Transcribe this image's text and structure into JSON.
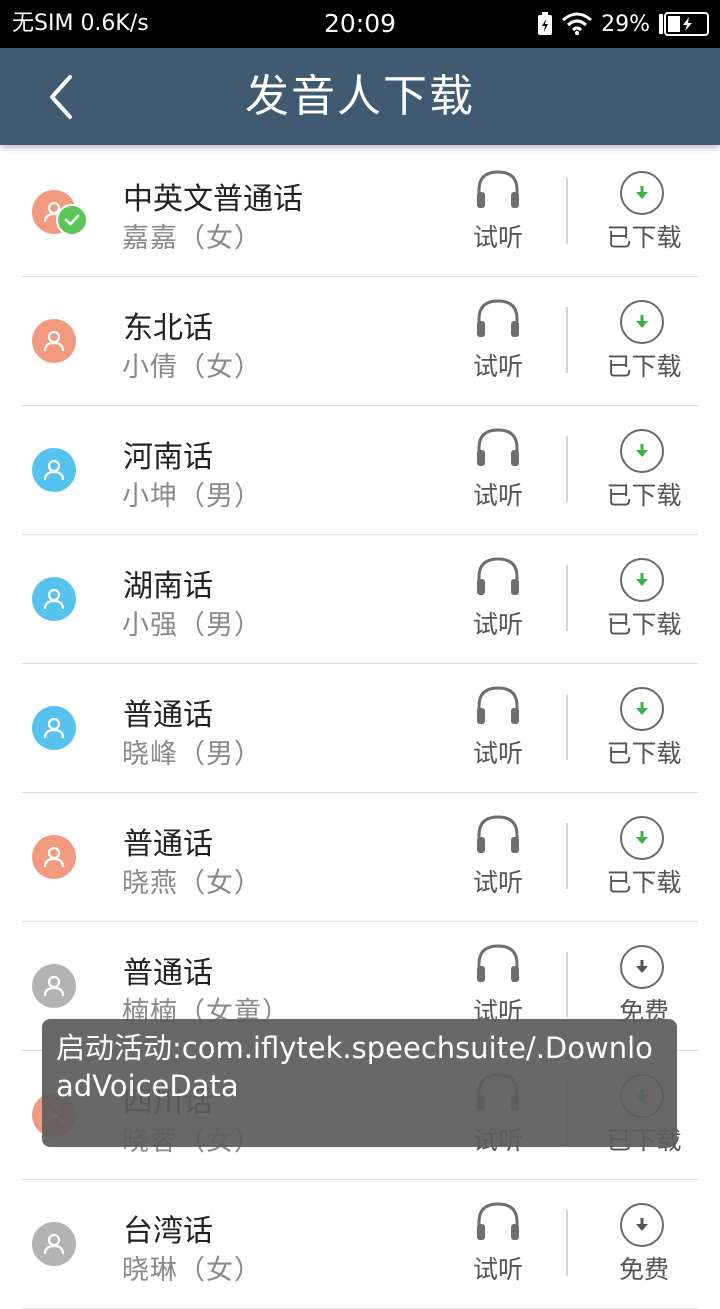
{
  "status_bar": {
    "carrier": "无SIM",
    "speed": "0.6K/s",
    "time": "20:09",
    "battery": "29%",
    "icons": [
      "battery-saver-icon",
      "wifi-icon",
      "battery-charging-icon"
    ]
  },
  "header": {
    "title": "发音人下载",
    "back_icon": "chevron-left-icon"
  },
  "colors": {
    "app_bar": "#3f5a71",
    "female": "#f29a7f",
    "male": "#55c3ee",
    "disabled": "#b3b3b3",
    "downloaded_arrow": "#3cb34a",
    "free_arrow": "#555555"
  },
  "list": [
    {
      "language": "中英文普通话",
      "voice": "嘉嘉（女）",
      "listen_label": "试听",
      "action_label": "已下载",
      "avatar": "female",
      "selected": true
    },
    {
      "language": "东北话",
      "voice": "小倩（女）",
      "listen_label": "试听",
      "action_label": "已下载",
      "avatar": "female",
      "selected": false
    },
    {
      "language": "河南话",
      "voice": "小坤（男）",
      "listen_label": "试听",
      "action_label": "已下载",
      "avatar": "male",
      "selected": false
    },
    {
      "language": "湖南话",
      "voice": "小强（男）",
      "listen_label": "试听",
      "action_label": "已下载",
      "avatar": "male",
      "selected": false
    },
    {
      "language": "普通话",
      "voice": "晓峰（男）",
      "listen_label": "试听",
      "action_label": "已下载",
      "avatar": "male",
      "selected": false
    },
    {
      "language": "普通话",
      "voice": "晓燕（女）",
      "listen_label": "试听",
      "action_label": "已下载",
      "avatar": "female",
      "selected": false
    },
    {
      "language": "普通话",
      "voice": "楠楠（女童）",
      "listen_label": "试听",
      "action_label": "免费",
      "avatar": "disabled",
      "selected": false
    },
    {
      "language": "四川话",
      "voice": "晓蓉（女）",
      "listen_label": "试听",
      "action_label": "已下载",
      "avatar": "female",
      "selected": false
    },
    {
      "language": "台湾话",
      "voice": "晓琳（女）",
      "listen_label": "试听",
      "action_label": "免费",
      "avatar": "disabled",
      "selected": false
    }
  ],
  "toast": {
    "text": "启动活动:com.iflytek.speechsuite/.DownloadVoiceData"
  }
}
